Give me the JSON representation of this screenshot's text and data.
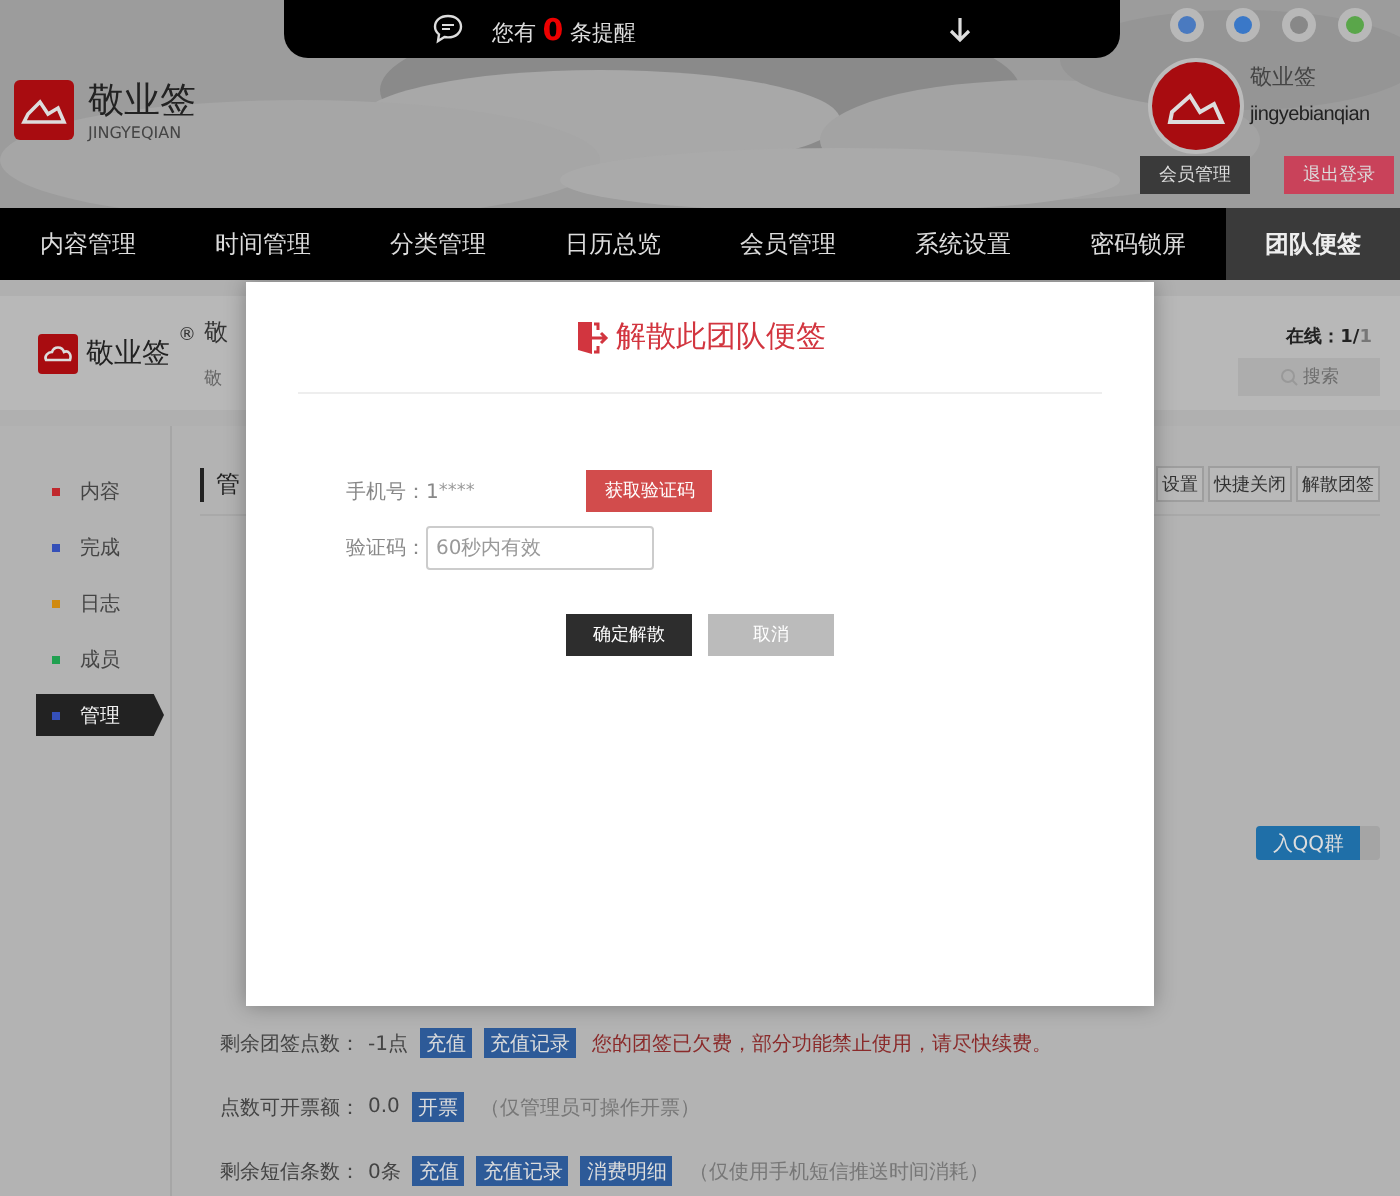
{
  "notice": {
    "prefix": "您有",
    "count": "0",
    "suffix": "条提醒"
  },
  "brand": {
    "name": "敬业签",
    "pinyin": "JINGYEQIAN"
  },
  "user": {
    "name": "敬业签",
    "account": "jingyebianqian",
    "buttons": [
      {
        "label": "会员管理",
        "kind": "dark"
      },
      {
        "label": "退出登录",
        "kind": "red"
      }
    ]
  },
  "nav": [
    {
      "label": "内容管理",
      "selected": false
    },
    {
      "label": "时间管理",
      "selected": false
    },
    {
      "label": "分类管理",
      "selected": false
    },
    {
      "label": "日历总览",
      "selected": false
    },
    {
      "label": "会员管理",
      "selected": false
    },
    {
      "label": "系统设置",
      "selected": false
    },
    {
      "label": "密码锁屏",
      "selected": false
    },
    {
      "label": "团队便签",
      "selected": true
    }
  ],
  "subheader": {
    "logo": "敬业签",
    "reg": "®",
    "team_name": "敬",
    "team_desc": "敬",
    "online_label": "在线：1/",
    "online_total": "1",
    "search_placeholder": "搜索"
  },
  "sidebar": [
    {
      "label": "内容",
      "color": "#c0282d",
      "selected": false
    },
    {
      "label": "完成",
      "color": "#3550b8",
      "selected": false
    },
    {
      "label": "日志",
      "color": "#d08a10",
      "selected": false
    },
    {
      "label": "成员",
      "color": "#20a050",
      "selected": false
    },
    {
      "label": "管理",
      "color": "#3550b8",
      "selected": true
    }
  ],
  "main": {
    "heading": "管",
    "actions": [
      "设置",
      "快捷关闭",
      "解散团签"
    ],
    "qq_button": "入QQ群",
    "rows": [
      {
        "label": "剩余团签点数：",
        "value": "-1点",
        "buttons": [
          "充值",
          "充值记录"
        ],
        "note": "您的团签已欠费，部分功能禁止使用，请尽快续费。",
        "warning": true
      },
      {
        "label": "点数可开票额：",
        "value": "0.0",
        "buttons": [
          "开票"
        ],
        "note": "（仅管理员可操作开票）",
        "warning": false
      },
      {
        "label": "剩余短信条数：",
        "value": "0条",
        "buttons": [
          "充值",
          "充值记录",
          "消费明细"
        ],
        "note": "（仅使用手机短信推送时间消耗）",
        "warning": false
      }
    ]
  },
  "dialog": {
    "title": "解散此团队便签",
    "phone_label": "手机号：",
    "phone_value": "1",
    "phone_mask": "****",
    "code_button": "获取验证码",
    "code_label": "验证码：",
    "code_placeholder": "60秒内有效",
    "confirm": "确定解散",
    "cancel": "取消"
  }
}
